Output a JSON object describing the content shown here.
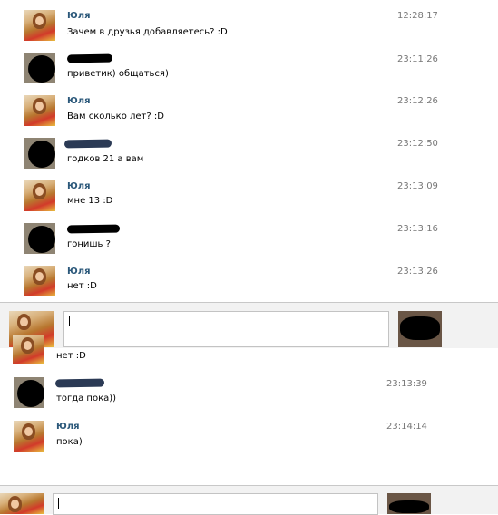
{
  "messages_top": [
    {
      "name": "Юля",
      "text": "Зачем в друзья добавляетесь? :D",
      "time": "12:28:17"
    },
    {
      "name": "",
      "text": "приветик) общаться)",
      "time": "23:11:26"
    },
    {
      "name": "Юля",
      "text": "Вам сколько лет? :D",
      "time": "23:12:26"
    },
    {
      "name": "",
      "text": "годков 21 а вам",
      "time": "23:12:50"
    },
    {
      "name": "Юля",
      "text": "мне 13 :D",
      "time": "23:13:09"
    },
    {
      "name": "",
      "text": "гонишь ?",
      "time": "23:13:16"
    },
    {
      "name": "Юля",
      "text": "нет :D",
      "time": "23:13:26"
    }
  ],
  "messages_bottom": [
    {
      "name": "",
      "text": "нет :D",
      "time": ""
    },
    {
      "name": "",
      "text": "тогда пока))",
      "time": "23:13:39"
    },
    {
      "name": "Юля",
      "text": "пока)",
      "time": "23:14:14"
    }
  ],
  "compose": {
    "value": ""
  },
  "colors": {
    "name": "#2b587a",
    "time": "#777777",
    "divider": "#c8c8c8"
  }
}
